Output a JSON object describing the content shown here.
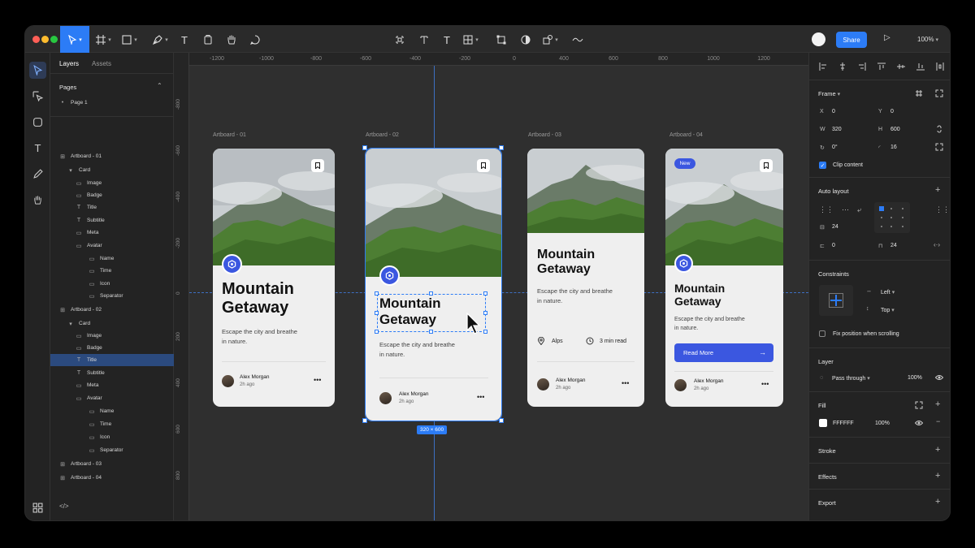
{
  "toolbar": {
    "share": "Share",
    "zoom": "100%",
    "accent": "#2c7cf6"
  },
  "layers_panel": {
    "tabs": [
      "Layers",
      "Assets"
    ],
    "pages_heading": "Pages",
    "pages": [
      "Page 1"
    ],
    "tree": [
      {
        "label": "Artboard - 01",
        "icon": "frame-icon",
        "depth": 0
      },
      {
        "label": "Card",
        "icon": "chevron-down-icon",
        "depth": 1
      },
      {
        "label": "Image",
        "icon": "folder-icon",
        "depth": 2
      },
      {
        "label": "Badge",
        "icon": "folder-icon",
        "depth": 2
      },
      {
        "label": "Title",
        "icon": "text-icon",
        "depth": 2
      },
      {
        "label": "Subtitle",
        "icon": "text-icon",
        "depth": 2
      },
      {
        "label": "Meta",
        "icon": "folder-icon",
        "depth": 2
      },
      {
        "label": "Avatar",
        "icon": "folder-icon",
        "depth": 2
      },
      {
        "label": "Name",
        "icon": "folder-icon",
        "depth": 3
      },
      {
        "label": "Time",
        "icon": "folder-icon",
        "depth": 3
      },
      {
        "label": "Icon",
        "icon": "folder-icon",
        "depth": 3
      },
      {
        "label": "Separator",
        "icon": "folder-icon",
        "depth": 3
      },
      {
        "label": "Artboard - 02",
        "icon": "frame-icon",
        "depth": 0
      },
      {
        "label": "Card",
        "icon": "chevron-down-icon",
        "depth": 1
      },
      {
        "label": "Image",
        "icon": "folder-icon",
        "depth": 2
      },
      {
        "label": "Badge",
        "icon": "folder-icon",
        "depth": 2
      },
      {
        "label": "Title",
        "icon": "text-icon",
        "depth": 2,
        "selected": true
      },
      {
        "label": "Subtitle",
        "icon": "text-icon",
        "depth": 2
      },
      {
        "label": "Meta",
        "icon": "folder-icon",
        "depth": 2
      },
      {
        "label": "Avatar",
        "icon": "folder-icon",
        "depth": 2
      },
      {
        "label": "Name",
        "icon": "folder-icon",
        "depth": 3
      },
      {
        "label": "Time",
        "icon": "folder-icon",
        "depth": 3
      },
      {
        "label": "Icon",
        "icon": "folder-icon",
        "depth": 3
      },
      {
        "label": "Separator",
        "icon": "folder-icon",
        "depth": 3
      },
      {
        "label": "Artboard - 03",
        "icon": "frame-icon",
        "depth": 0
      },
      {
        "label": "Artboard - 04",
        "icon": "frame-icon",
        "depth": 0
      }
    ]
  },
  "ruler": {
    "h": [
      "-1200",
      "-1000",
      "-800",
      "-600",
      "-400",
      "-200",
      "0",
      "400",
      "600",
      "800",
      "1000",
      "1200"
    ],
    "v": [
      "-800",
      "-600",
      "-400",
      "-200",
      "0",
      "200",
      "400",
      "600",
      "800",
      "800"
    ]
  },
  "artboards": [
    {
      "label": "Artboard - 01",
      "title": "Mountain Getaway",
      "subtitle": "Escape the city and breathe in nature.",
      "author": "Alex Morgan",
      "time": "2h ago"
    },
    {
      "label": "Artboard - 02",
      "title": "Mountain Getaway",
      "subtitle": "Escape the city and breathe in nature.",
      "author": "Alex Morgan",
      "time": "2h ago",
      "size_tag": "320 × 600"
    },
    {
      "label": "Artboard - 03",
      "title": "Mountain Getaway",
      "subtitle": "Escape the city and breathe in nature.",
      "location": "Alps",
      "read_time": "3 min read",
      "author": "Alex Morgan",
      "time": "2h ago"
    },
    {
      "label": "Artboard - 04",
      "badge": "New",
      "title": "Mountain Getaway",
      "subtitle": "Escape the city and breathe in nature.",
      "button": "Read More",
      "author": "Alex Morgan",
      "time": "2h ago"
    }
  ],
  "card_colors": {
    "accent": "#3b57e0",
    "card_bg": "#efefef"
  },
  "props": {
    "frame": {
      "heading": "Frame",
      "x_label": "X",
      "x": "0",
      "y_label": "Y",
      "y": "0",
      "w_label": "W",
      "w": "320",
      "h_label": "H",
      "h": "600",
      "rotation": "0°",
      "radius": "16",
      "clip": "Clip content"
    },
    "auto_layout": {
      "heading": "Auto layout",
      "gap": "24",
      "padding_h": "0",
      "padding_v": "24"
    },
    "constraints": {
      "heading": "Constraints",
      "horizontal": "Left",
      "vertical": "Top",
      "fix": "Fix position when scrolling"
    },
    "layer": {
      "heading": "Layer",
      "blend": "Pass through",
      "opacity": "100%"
    },
    "fill": {
      "heading": "Fill",
      "hex": "FFFFFF",
      "opacity": "100%"
    },
    "stroke": "Stroke",
    "effects": "Effects",
    "export": "Export"
  }
}
